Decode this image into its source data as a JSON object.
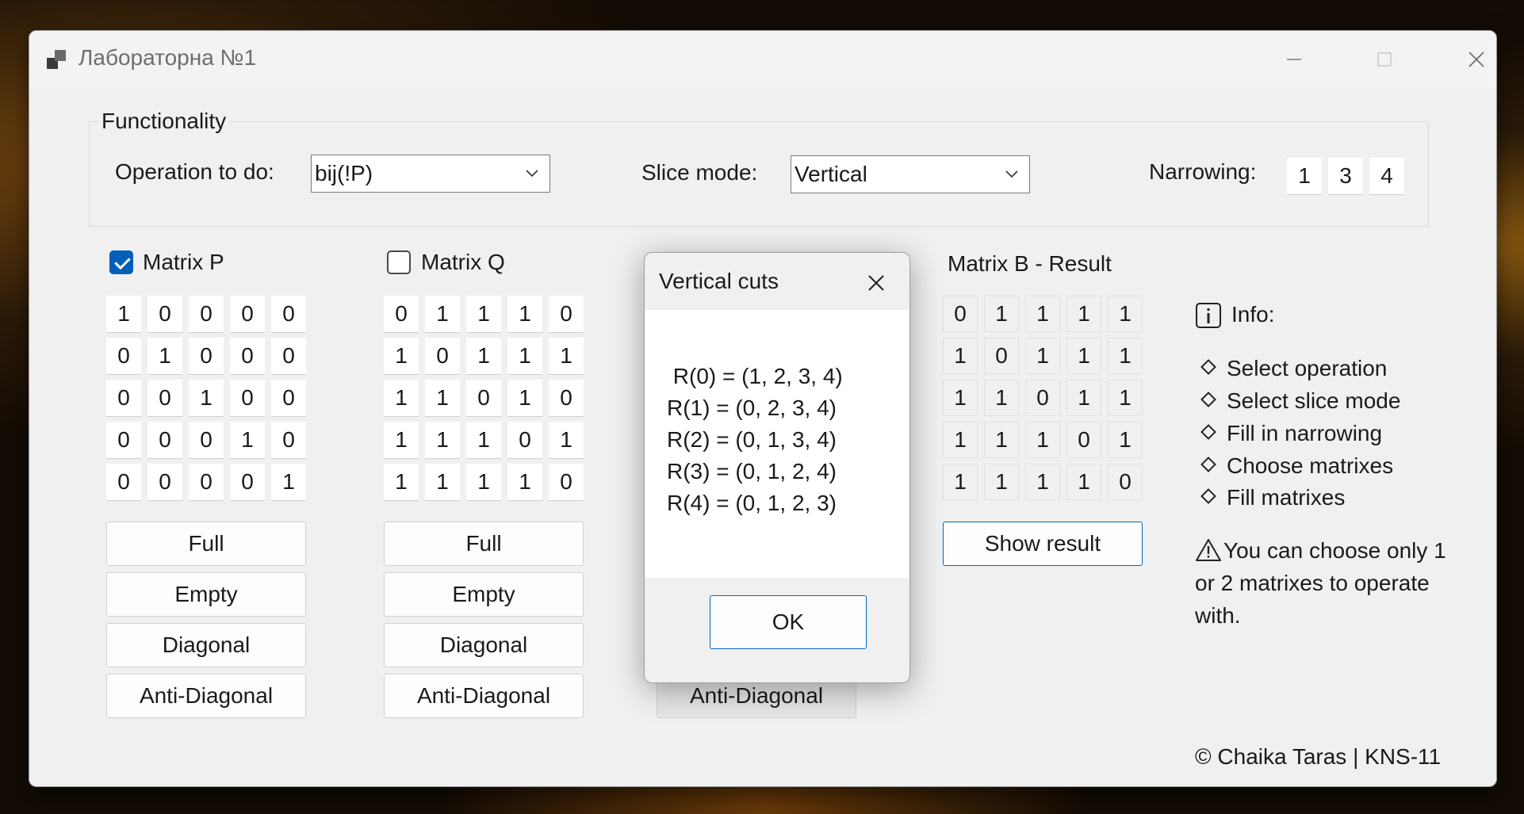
{
  "window": {
    "title": "Лабораторна №1"
  },
  "functionality": {
    "legend": "Functionality",
    "operation_label": "Operation to do:",
    "operation_value": "bij(!P)",
    "slice_label": "Slice mode:",
    "slice_value": "Vertical",
    "narrowing_label": "Narrowing:",
    "narrowing_values": [
      "1",
      "3",
      "4"
    ]
  },
  "matrix_p": {
    "label": "Matrix P",
    "checked": true,
    "rows": [
      [
        "1",
        "0",
        "0",
        "0",
        "0"
      ],
      [
        "0",
        "1",
        "0",
        "0",
        "0"
      ],
      [
        "0",
        "0",
        "1",
        "0",
        "0"
      ],
      [
        "0",
        "0",
        "0",
        "1",
        "0"
      ],
      [
        "0",
        "0",
        "0",
        "0",
        "1"
      ]
    ],
    "buttons": [
      "Full",
      "Empty",
      "Diagonal",
      "Anti-Diagonal"
    ]
  },
  "matrix_q": {
    "label": "Matrix Q",
    "checked": false,
    "rows": [
      [
        "0",
        "1",
        "1",
        "1",
        "0"
      ],
      [
        "1",
        "0",
        "1",
        "1",
        "1"
      ],
      [
        "1",
        "1",
        "0",
        "1",
        "0"
      ],
      [
        "1",
        "1",
        "1",
        "0",
        "1"
      ],
      [
        "1",
        "1",
        "1",
        "1",
        "0"
      ]
    ],
    "buttons": [
      "Full",
      "Empty",
      "Diagonal",
      "Anti-Diagonal"
    ]
  },
  "matrix_third": {
    "buttons": [
      "Anti-Diagonal"
    ]
  },
  "matrix_b": {
    "label": "Matrix B - Result",
    "rows": [
      [
        "0",
        "1",
        "1",
        "1",
        "1"
      ],
      [
        "1",
        "0",
        "1",
        "1",
        "1"
      ],
      [
        "1",
        "1",
        "0",
        "1",
        "1"
      ],
      [
        "1",
        "1",
        "1",
        "0",
        "1"
      ],
      [
        "1",
        "1",
        "1",
        "1",
        "0"
      ]
    ],
    "show_result_label": "Show result"
  },
  "info": {
    "title": "Info:",
    "items": [
      "Select operation",
      "Select slice mode",
      "Fill in narrowing",
      "Choose matrixes",
      "Fill matrixes"
    ],
    "warning_lines": [
      "You can choose only 1",
      "or 2 matrixes to operate",
      "with."
    ]
  },
  "footer": {
    "copyright": "© Chaika Taras | KNS-11"
  },
  "dialog": {
    "title": "Vertical cuts",
    "lines": [
      " R(0) = (1, 2, 3, 4)",
      "R(1) = (0, 2, 3, 4)",
      "R(2) = (0, 1, 3, 4)",
      "R(3) = (0, 1, 2, 4)",
      "R(4) = (0, 1, 2, 3)"
    ],
    "ok_label": "OK"
  },
  "colors": {
    "accent": "#005fb8",
    "focus_border": "#0067c0",
    "window_bg": "#f0f0f0"
  }
}
